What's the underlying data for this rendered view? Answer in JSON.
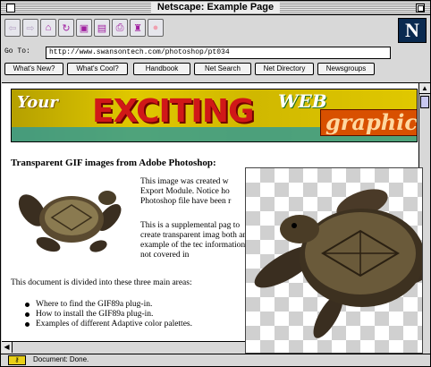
{
  "window": {
    "title": "Netscape: Example Page"
  },
  "toolbar": {
    "buttons": [
      {
        "icon": "back-arrow-icon",
        "glyph": "⇦"
      },
      {
        "icon": "forward-arrow-icon",
        "glyph": "⇨"
      },
      {
        "icon": "home-icon",
        "glyph": "⌂"
      },
      {
        "icon": "reload-icon",
        "glyph": "↻"
      },
      {
        "icon": "images-icon",
        "glyph": "▣"
      },
      {
        "icon": "open-icon",
        "glyph": "▤"
      },
      {
        "icon": "print-icon",
        "glyph": "⎙"
      },
      {
        "icon": "find-icon",
        "glyph": "♜"
      },
      {
        "icon": "stop-icon",
        "glyph": "●"
      }
    ],
    "logo": "N"
  },
  "location": {
    "label": "Go To:",
    "url": "http://www.swansontech.com/photoshop/pt034"
  },
  "directory_buttons": [
    "What's New?",
    "What's Cool?",
    "Handbook",
    "Net Search",
    "Net Directory",
    "Newsgroups"
  ],
  "page": {
    "banner": {
      "your": "Your",
      "exciting": "EXCITING",
      "web": "WEB",
      "graphic": "graphic"
    },
    "heading": "Transparent GIF images from Adobe Photoshop:",
    "para1": "This image was created w Export Module. Notice ho Photoshop file have been r",
    "para2": "This is a supplemental pag to create transparent imag both an example of the tec information not covered in",
    "intro": "This document is divided into these three main areas:",
    "bullets": [
      "Where to find the GIF89a plug-in.",
      "How to install the GIF89a plug-in.",
      "Examples of different Adaptive color palettes."
    ]
  },
  "status": {
    "text": "Document: Done."
  },
  "colors": {
    "accent": "#a020a0",
    "banner_red": "#d01818",
    "logo_bg": "#0a2a50"
  }
}
